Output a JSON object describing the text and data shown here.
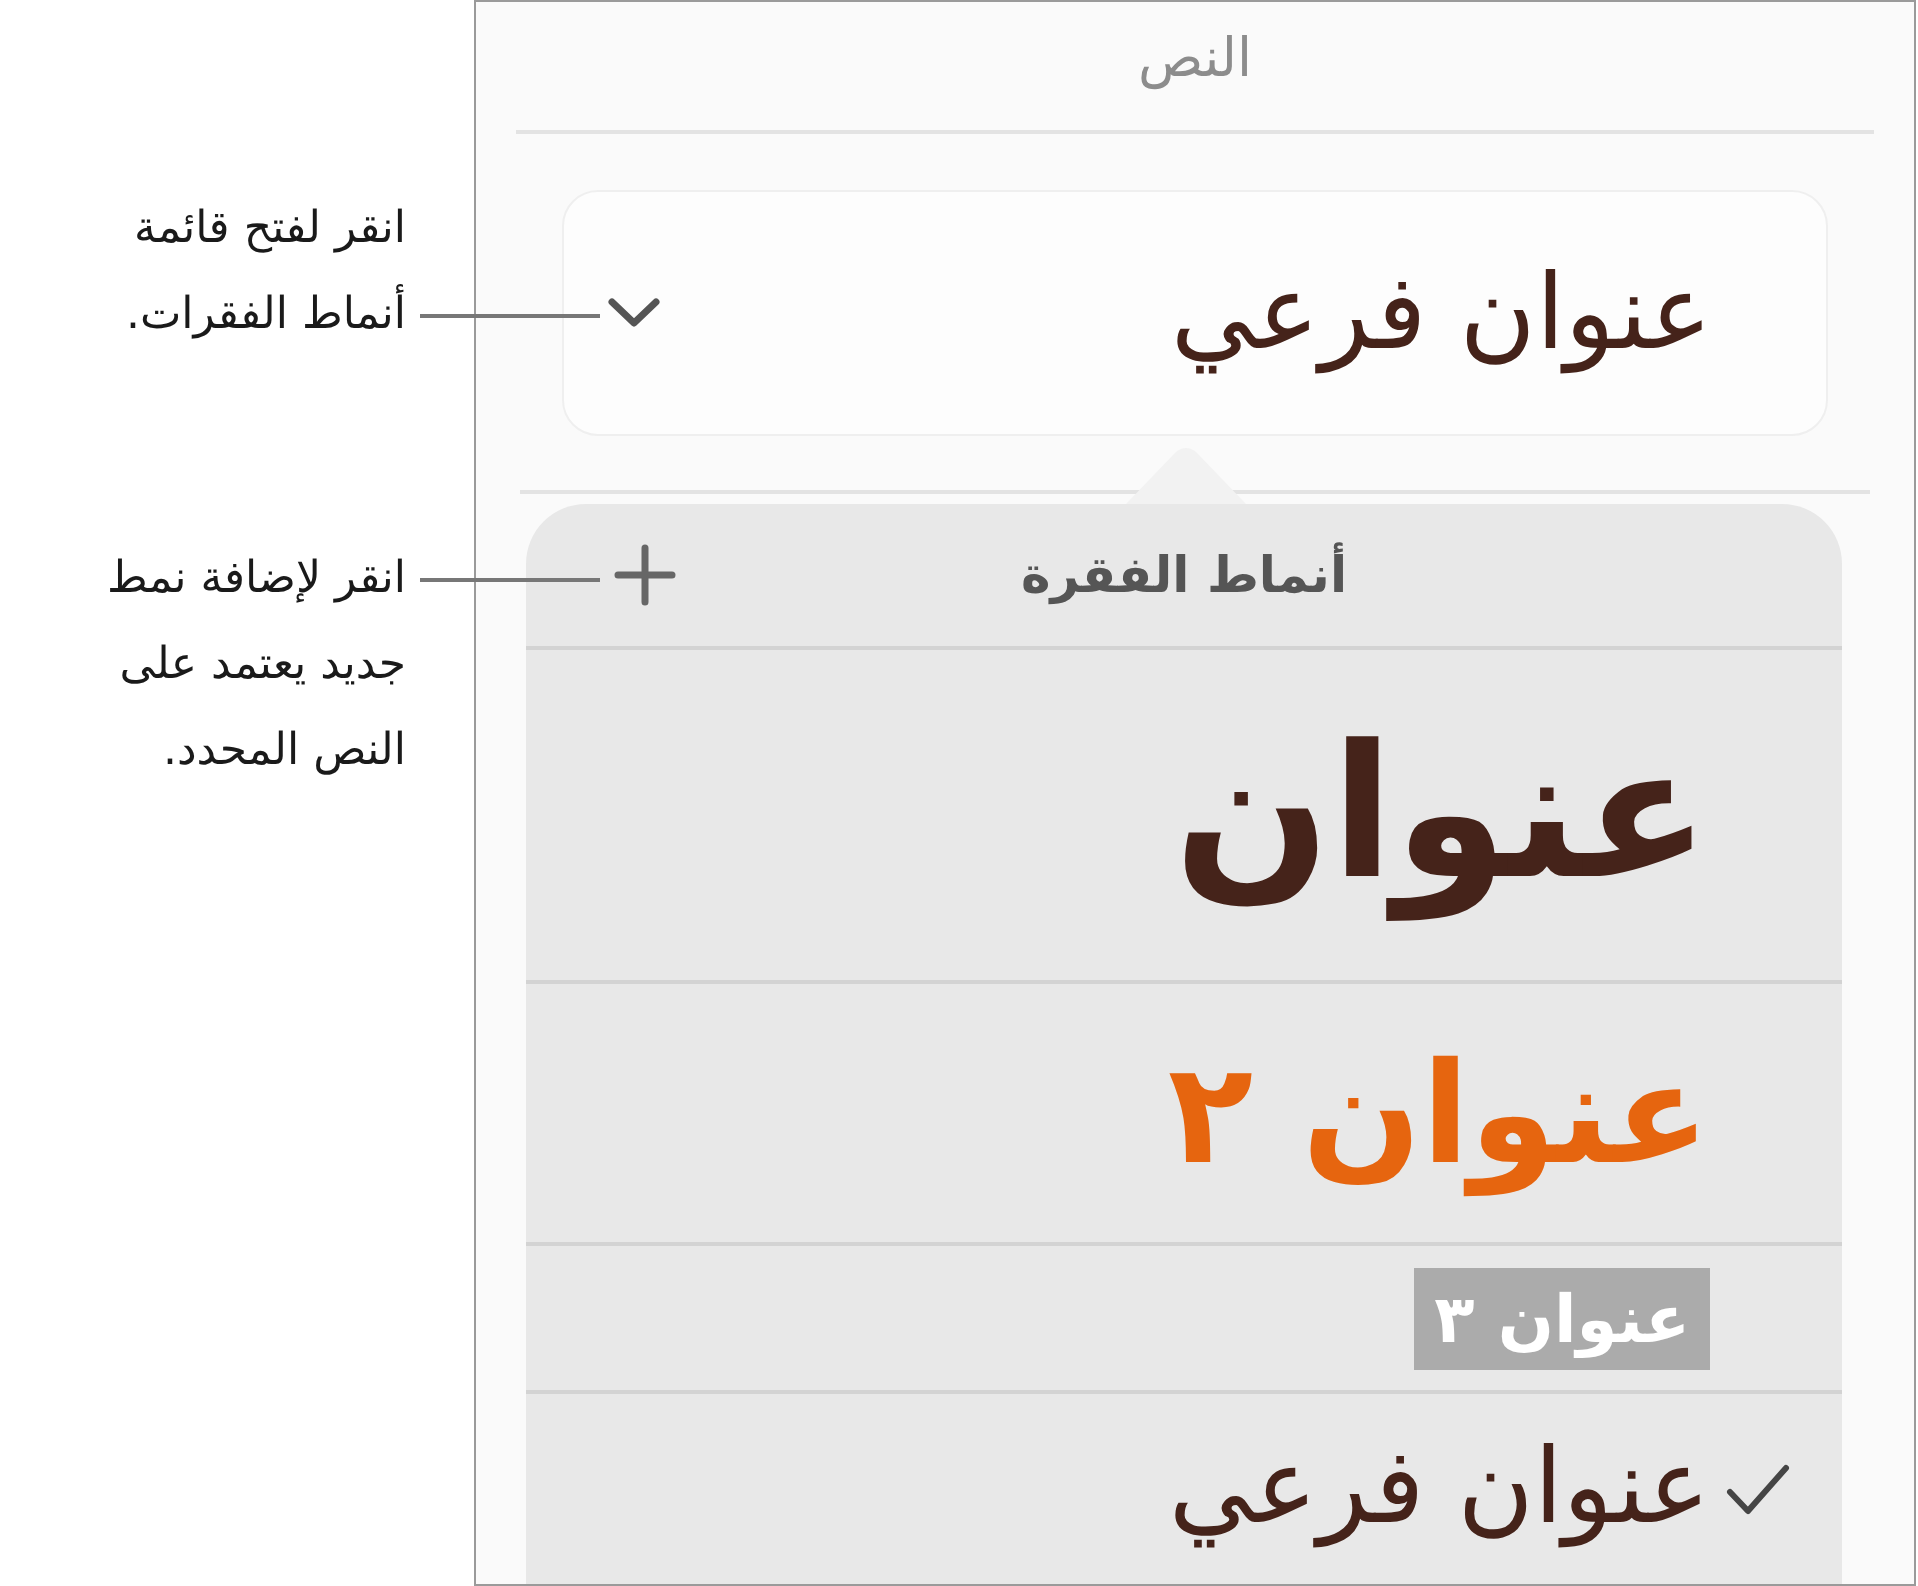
{
  "callouts": [
    {
      "text": "انقر لفتح قائمة أنماط الفقرات."
    },
    {
      "text": "انقر لإضافة نمط جديد يعتمد على النص المحدد."
    }
  ],
  "panel": {
    "title": "النص",
    "style_selector": {
      "value": "عنوان فرعي"
    },
    "popover": {
      "title": "أنماط الفقرة",
      "styles": [
        {
          "label": "عنوان",
          "kind": "title",
          "selected": false
        },
        {
          "label": "عنوان ٢",
          "kind": "heading2",
          "selected": false
        },
        {
          "label": "عنوان ٣",
          "kind": "heading3",
          "selected": false
        },
        {
          "label": "عنوان فرعي",
          "kind": "subtitle",
          "selected": true
        }
      ]
    }
  }
}
